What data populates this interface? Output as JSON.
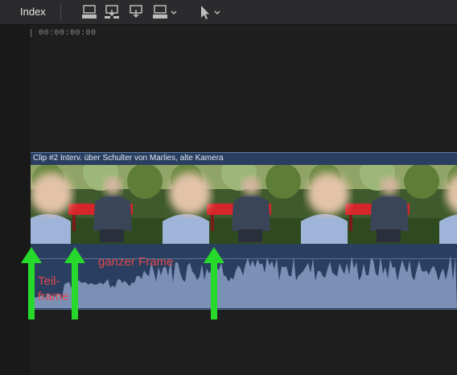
{
  "toolbar": {
    "index_label": "Index",
    "icons": [
      "append-icon",
      "insert-icon",
      "connect-icon",
      "overwrite-dropdown-icon",
      "pointer-tool-dropdown-icon"
    ]
  },
  "timeline": {
    "timecode": "00:00:00:00"
  },
  "clip": {
    "title": "Clip #2 Interv. über Schulter von Marlies, alte Kamera"
  },
  "annotations": {
    "partial_frame": "Teil-\nframe",
    "full_frame": "ganzer Frame"
  },
  "colors": {
    "background": "#1e1e1f",
    "clip_blue": "#2a3f60",
    "waveform": "#7a90b5",
    "arrow_green": "#27d92b",
    "annotation_red": "#e0474c"
  }
}
